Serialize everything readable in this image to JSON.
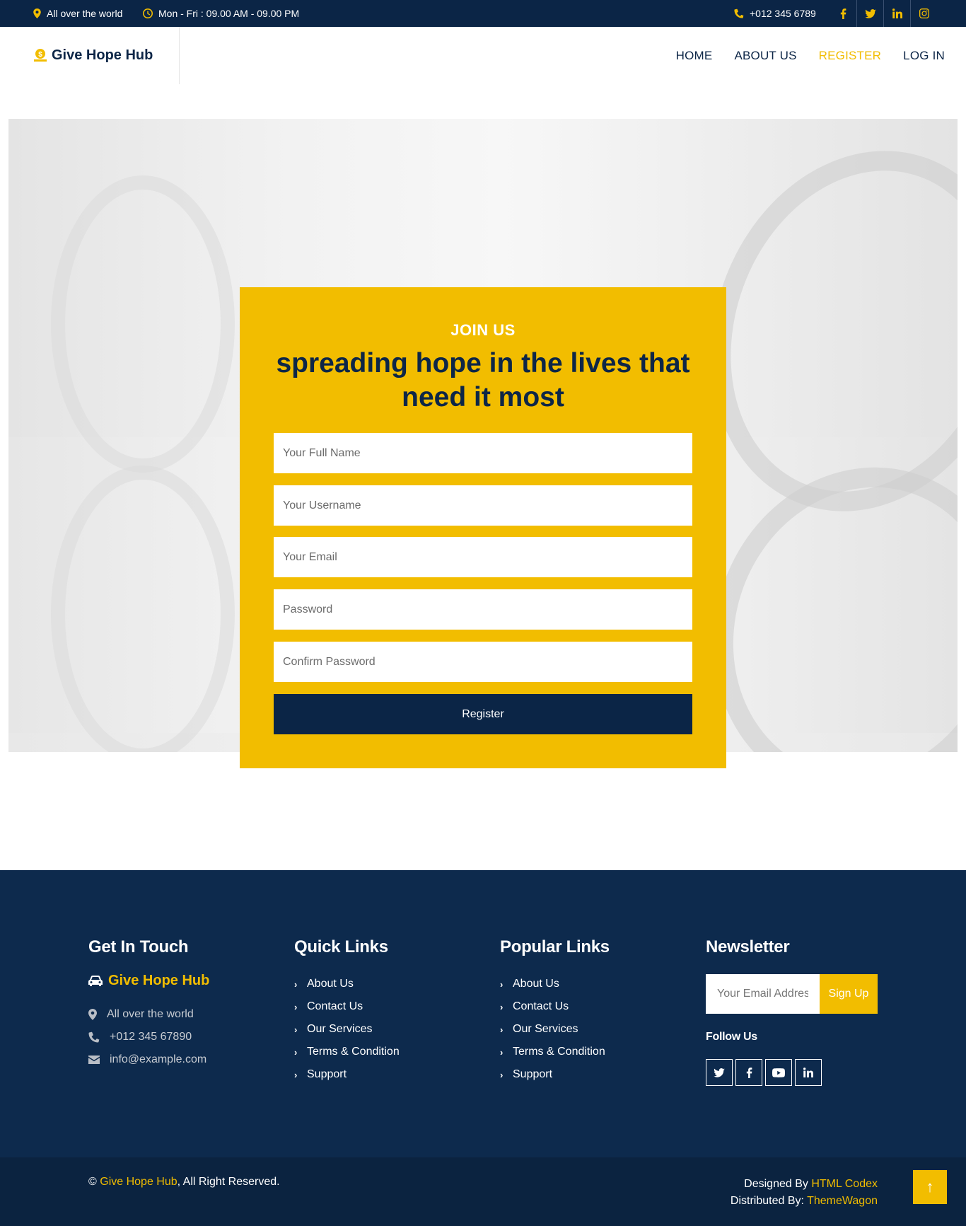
{
  "topbar": {
    "location": "All over the world",
    "hours": "Mon - Fri : 09.00 AM - 09.00 PM",
    "phone": "+012 345 6789",
    "socials": [
      "facebook-icon",
      "twitter-icon",
      "linkedin-icon",
      "instagram-icon"
    ]
  },
  "nav": {
    "brand": "Give Hope Hub",
    "links": [
      {
        "label": "HOME"
      },
      {
        "label": "ABOUT US"
      },
      {
        "label": "REGISTER",
        "active": true
      },
      {
        "label": "LOG IN"
      }
    ]
  },
  "hero": {
    "eyebrow": "JOIN US",
    "headline": "spreading hope in the lives that need it most",
    "fields": {
      "full_name": "Your Full Name",
      "username": "Your Username",
      "email": "Your Email",
      "password": "Password",
      "confirm_password": "Confirm Password"
    },
    "submit_label": "Register"
  },
  "footer": {
    "contact": {
      "title": "Get In Touch",
      "brand": "Give Hope Hub",
      "address": "All over the world",
      "phone": "+012 345 67890",
      "email": "info@example.com"
    },
    "quick_links": {
      "title": "Quick Links",
      "items": [
        "About Us",
        "Contact Us",
        "Our Services",
        "Terms & Condition",
        "Support"
      ]
    },
    "popular_links": {
      "title": "Popular Links",
      "items": [
        "About Us",
        "Contact Us",
        "Our Services",
        "Terms & Condition",
        "Support"
      ]
    },
    "newsletter": {
      "title": "Newsletter",
      "placeholder": "Your Email Address",
      "button": "Sign Up",
      "follow_title": "Follow Us",
      "icons": [
        "twitter-icon",
        "facebook-icon",
        "youtube-icon",
        "linkedin-icon"
      ]
    }
  },
  "bottom": {
    "copyright_symbol": "©",
    "copyright_brand": "Give Hope Hub",
    "copyright_rest": ", All Right Reserved.",
    "designed_by_label": "Designed By",
    "designed_by": "HTML Codex",
    "distributed_by_label": "Distributed By:",
    "distributed_by": "ThemeWagon"
  },
  "colors": {
    "accent": "#f2bd00",
    "navy": "#0b2546",
    "footer": "#0d2a4d"
  }
}
